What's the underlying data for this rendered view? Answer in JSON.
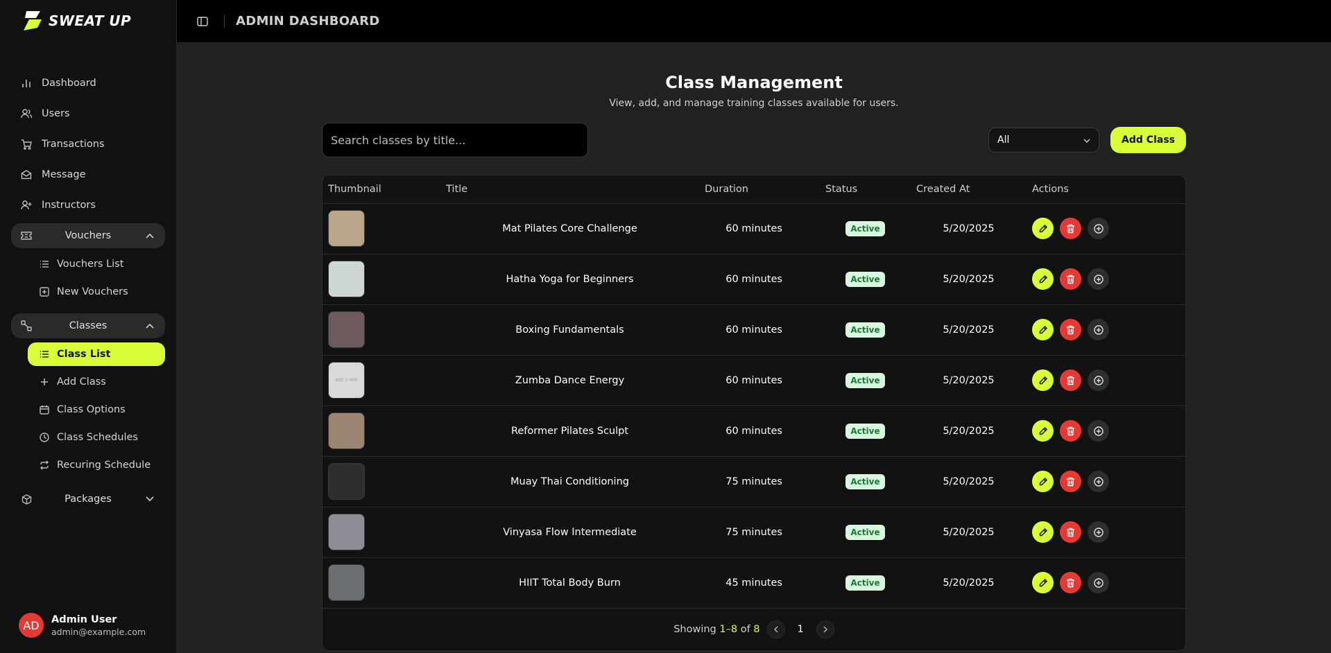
{
  "brand": {
    "name": "SWEAT UP",
    "accent": "#d8ff3a",
    "danger": "#e53935"
  },
  "topbar": {
    "title": "ADMIN DASHBOARD"
  },
  "sidebar": {
    "items": [
      {
        "label": "Dashboard",
        "icon": "bar-chart-icon"
      },
      {
        "label": "Users",
        "icon": "users-icon"
      },
      {
        "label": "Transactions",
        "icon": "cart-icon"
      },
      {
        "label": "Message",
        "icon": "mail-icon"
      },
      {
        "label": "Instructors",
        "icon": "user-plus-icon"
      }
    ],
    "groups": {
      "vouchers": {
        "label": "Vouchers",
        "items": [
          "Vouchers List",
          "New Vouchers"
        ]
      },
      "classes": {
        "label": "Classes",
        "items": [
          "Class List",
          "Add Class",
          "Class Options",
          "Class Schedules",
          "Recuring Schedule"
        ]
      },
      "packages": {
        "label": "Packages"
      }
    },
    "user": {
      "initials": "AD",
      "name": "Admin User",
      "email": "admin@example.com"
    }
  },
  "page": {
    "title": "Class Management",
    "subtitle": "View, add, and manage training classes available for users.",
    "search_placeholder": "Search classes by title...",
    "filter_value": "All",
    "add_label": "Add Class"
  },
  "table": {
    "headers": [
      "Thumbnail",
      "Title",
      "Duration",
      "Status",
      "Created At",
      "Actions"
    ],
    "rows": [
      {
        "title": "Mat Pilates Core Challenge",
        "duration": "60 minutes",
        "status": "Active",
        "created": "5/20/2025",
        "thumb": "#b8a58a"
      },
      {
        "title": "Hatha Yoga for Beginners",
        "duration": "60 minutes",
        "status": "Active",
        "created": "5/20/2025",
        "thumb": "#cfd7d3"
      },
      {
        "title": "Boxing Fundamentals",
        "duration": "60 minutes",
        "status": "Active",
        "created": "5/20/2025",
        "thumb": "#6d5a5a"
      },
      {
        "title": "Zumba Dance Energy",
        "duration": "60 minutes",
        "status": "Active",
        "created": "5/20/2025",
        "thumb": "#d9d9d9",
        "placeholder_text": "400 × 400"
      },
      {
        "title": "Reformer Pilates Sculpt",
        "duration": "60 minutes",
        "status": "Active",
        "created": "5/20/2025",
        "thumb": "#9a8672"
      },
      {
        "title": "Muay Thai Conditioning",
        "duration": "75 minutes",
        "status": "Active",
        "created": "5/20/2025",
        "thumb": "#2e2e30"
      },
      {
        "title": "Vinyasa Flow Intermediate",
        "duration": "75 minutes",
        "status": "Active",
        "created": "5/20/2025",
        "thumb": "#8f8c97"
      },
      {
        "title": "HIIT Total Body Burn",
        "duration": "45 minutes",
        "status": "Active",
        "created": "5/20/2025",
        "thumb": "#6b6f74"
      }
    ]
  },
  "pagination": {
    "prefix": "Showing",
    "range": "1–8",
    "of": "of",
    "total": "8",
    "page": "1"
  }
}
